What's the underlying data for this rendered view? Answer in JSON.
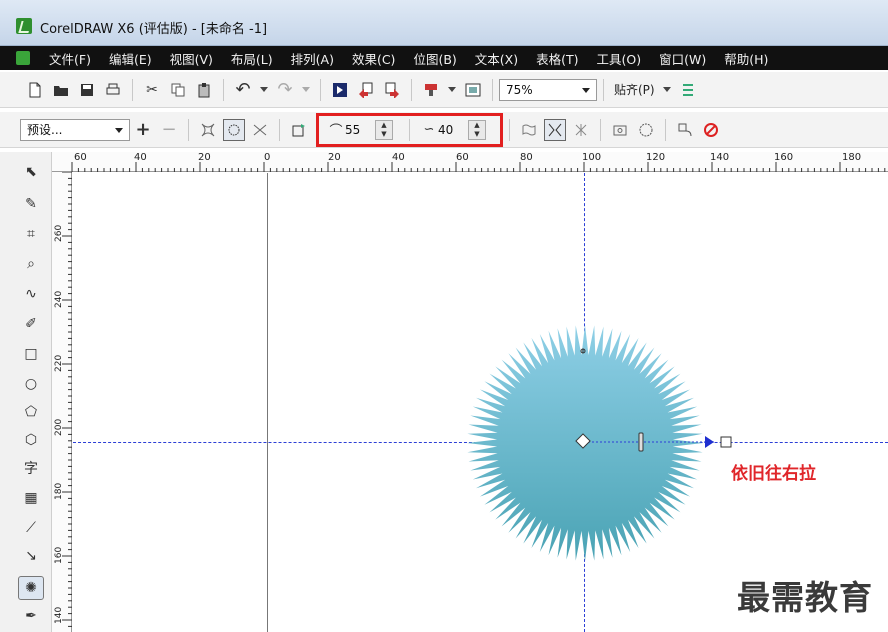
{
  "window": {
    "title": "CorelDRAW X6 (评估版) - [未命名 -1]"
  },
  "menu": [
    "文件(F)",
    "编辑(E)",
    "视图(V)",
    "布局(L)",
    "排列(A)",
    "效果(C)",
    "位图(B)",
    "文本(X)",
    "表格(T)",
    "工具(O)",
    "窗口(W)",
    "帮助(H)"
  ],
  "toolbar": {
    "zoom": "75%",
    "snap_label": "贴齐(P)"
  },
  "property_bar": {
    "preset": "预设...",
    "amplitude": "55",
    "frequency": "40"
  },
  "ruler": {
    "top_labels": [
      "60",
      "40",
      "20",
      "0",
      "20",
      "40",
      "60",
      "80",
      "100",
      "120",
      "140",
      "160",
      "180"
    ],
    "left_labels": [
      "260",
      "240",
      "220",
      "200",
      "180",
      "160",
      "140"
    ]
  },
  "canvas": {
    "annotation": "依旧往右拉",
    "watermark": "最需教育",
    "shape_fill_top": "#8ecfe6",
    "shape_fill_bottom": "#4aa3b4",
    "guide_color": "#2c3fd6"
  }
}
